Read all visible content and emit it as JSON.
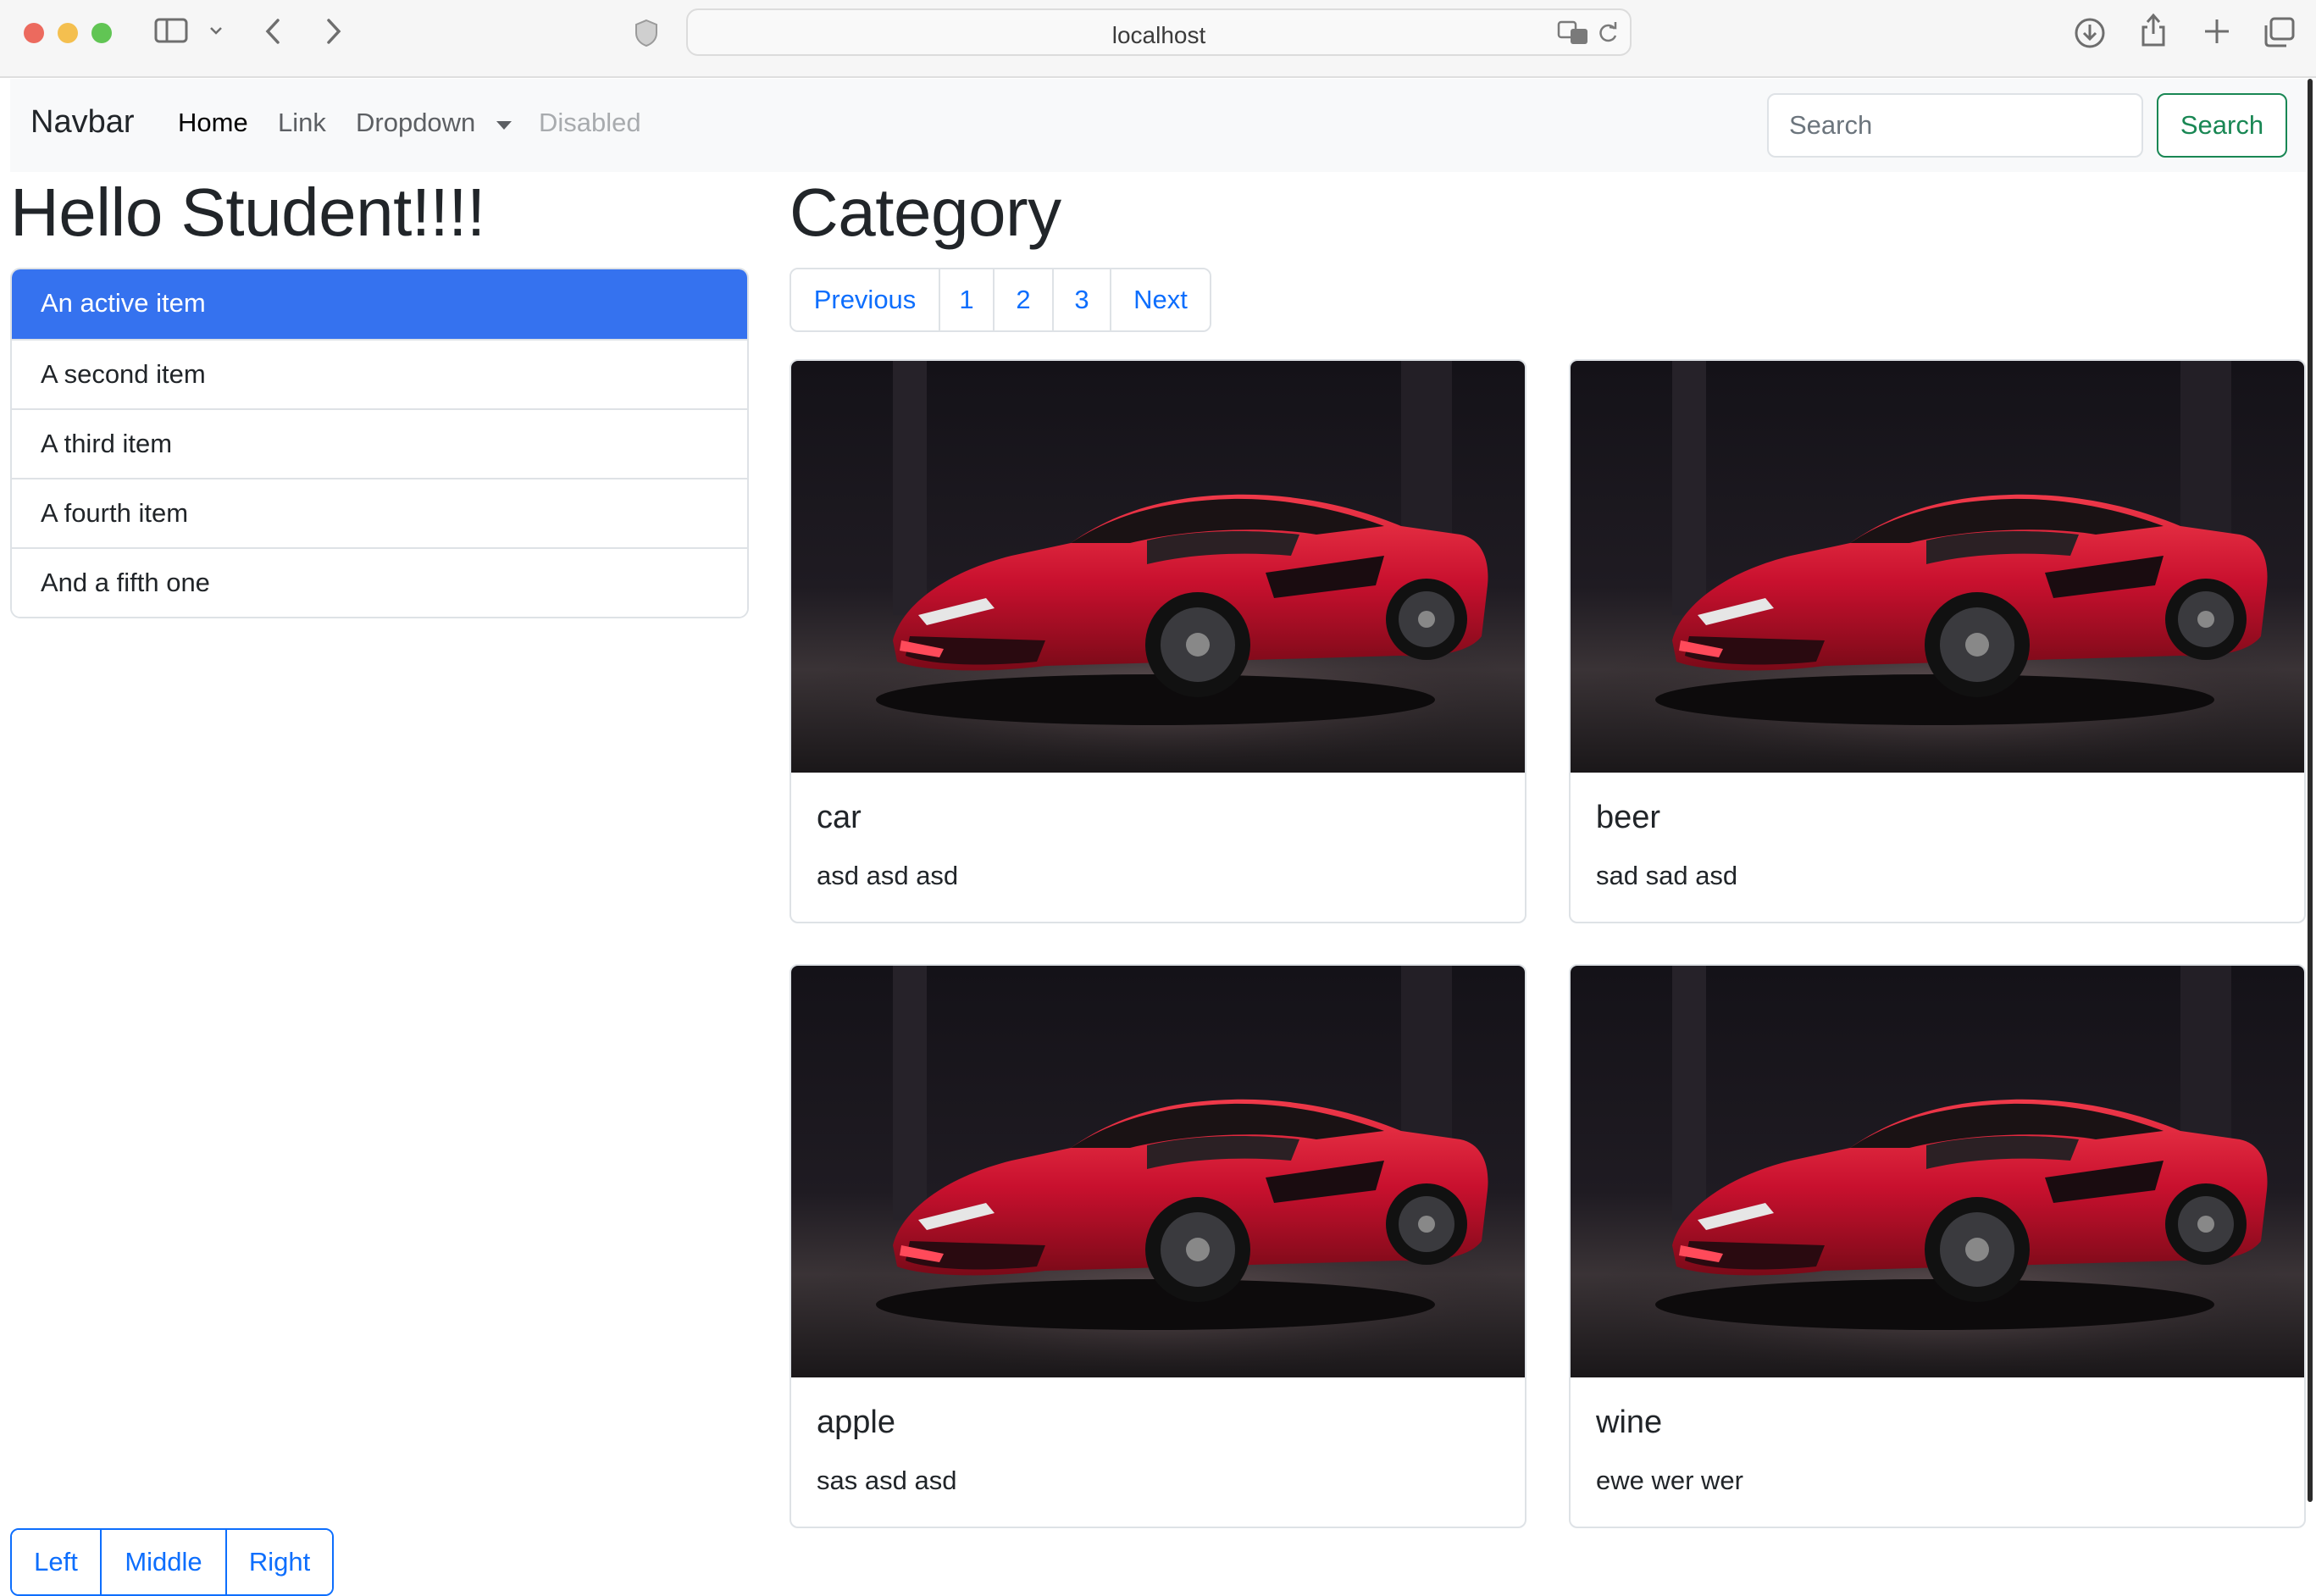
{
  "browser": {
    "url": "localhost",
    "icons": [
      "sidebar-icon",
      "chevron-down-icon",
      "back-icon",
      "forward-icon",
      "shield-icon",
      "translate-icon",
      "reload-icon",
      "download-icon",
      "share-icon",
      "new-tab-icon",
      "tabs-overview-icon"
    ]
  },
  "navbar": {
    "brand": "Navbar",
    "home": "Home",
    "link": "Link",
    "dropdown": "Dropdown",
    "disabled": "Disabled",
    "search_placeholder": "Search",
    "search_button": "Search"
  },
  "left": {
    "heading": "Hello Student!!!!",
    "list_items": [
      "An active item",
      "A second item",
      "A third item",
      "A fourth item",
      "And a fifth one"
    ],
    "button_group": [
      "Left",
      "Middle",
      "Right"
    ]
  },
  "main": {
    "heading": "Category",
    "pagination": [
      "Previous",
      "1",
      "2",
      "3",
      "Next"
    ],
    "cards": [
      {
        "title": "car",
        "text": "asd asd asd"
      },
      {
        "title": "beer",
        "text": "sad sad asd"
      },
      {
        "title": "apple",
        "text": "sas asd asd"
      },
      {
        "title": "wine",
        "text": "ewe wer wer"
      }
    ]
  },
  "colors": {
    "primary": "#0d6efd",
    "active_item": "#3572ef",
    "success": "#198754",
    "car_red": "#c8102e"
  }
}
